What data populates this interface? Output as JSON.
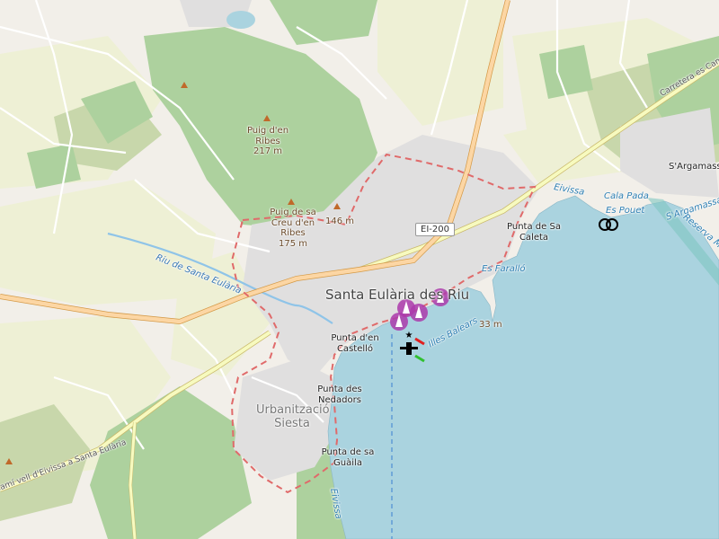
{
  "colors": {
    "sea": "#aad3df",
    "land": "#f2efe9",
    "farmland": "#eef0d5",
    "forest": "#add19e",
    "scrub": "#c8d7ab",
    "urban": "#e0dfdf",
    "boundary": "#e06a6a",
    "road_primary": "#f9c87f",
    "road_secondary": "#f7fabf",
    "poi": "#ac39ac"
  },
  "labels": {
    "town": "Santa Eulària des Riu",
    "suburb": "Urbanització Siesta",
    "peak_ribes_name": "Puig d'en Ribes",
    "peak_ribes_ele": "217 m",
    "peak_creu_name": "Puig de sa Creu d'en Ribes",
    "peak_creu_ele": "175 m",
    "peak_146": "146 m",
    "peak_33": "33 m",
    "cape_sa_caleta": "Punta de Sa Caleta",
    "cape_castello": "Punta d'en Castelló",
    "cape_nedadors": "Punta des Nedadors",
    "cape_guaila": "Punta de sa Guàila",
    "sargamassa": "S'Argamassa",
    "cala_pada": "Cala Pada",
    "es_pouet": "Es Pouet",
    "es_farallo": "Es Faralló",
    "argamassa_water": "S'Argamassa",
    "eivissa_1": "Eivissa",
    "eivissa_2": "Eivissa",
    "reserva": "Reserva Marina",
    "river": "Riu de Santa Eulària",
    "road_shield": "EI-200",
    "carretera": "Carretera es Caná",
    "cami_vell": "Camí vell d'Eivissa a Santa Eulària",
    "balears": "Illes Balears"
  }
}
